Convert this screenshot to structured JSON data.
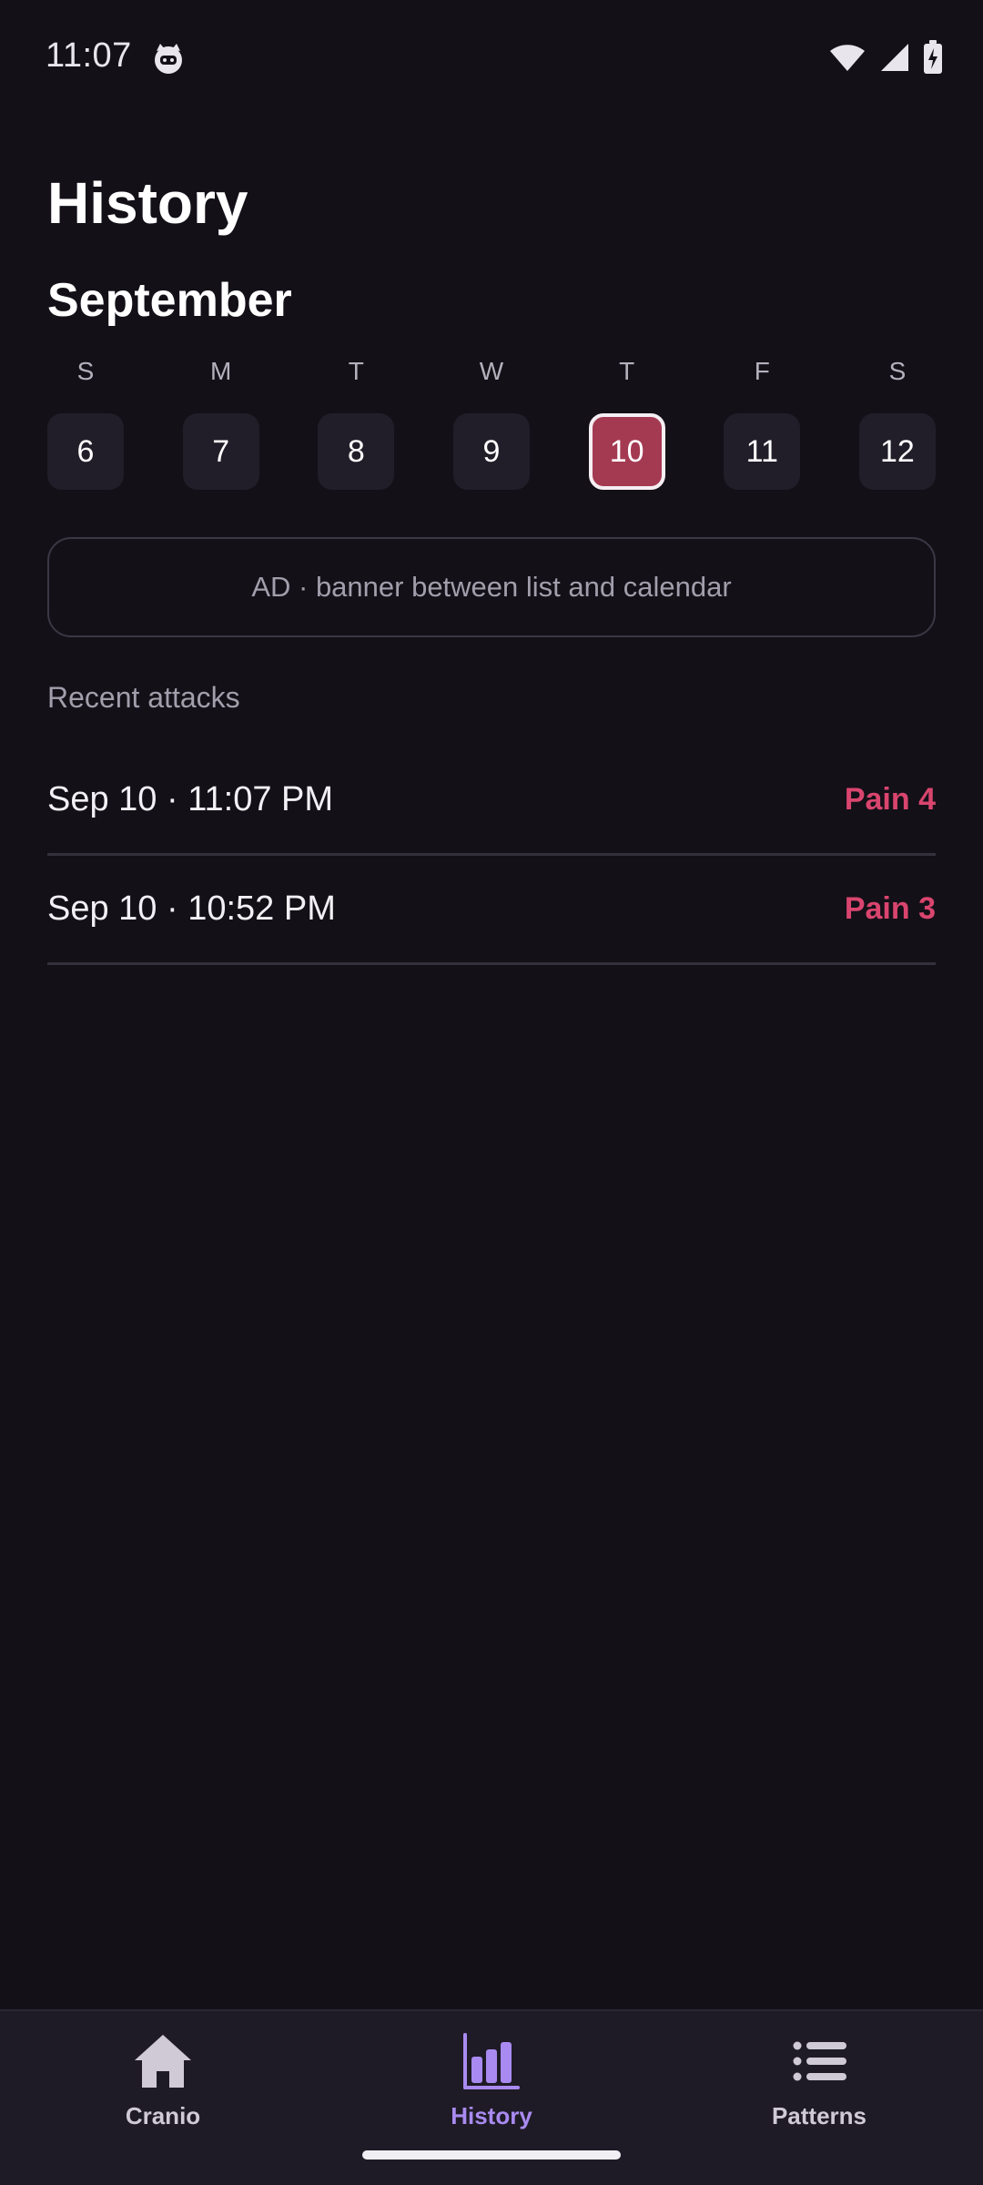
{
  "status_bar": {
    "time": "11:07",
    "app_icon": "cat-face-icon",
    "icons": [
      "wifi-icon",
      "signal-icon",
      "battery-charging-icon"
    ]
  },
  "page": {
    "title": "History",
    "month": "September"
  },
  "week": {
    "letters": [
      "S",
      "M",
      "T",
      "W",
      "T",
      "F",
      "S"
    ],
    "days": [
      "6",
      "7",
      "8",
      "9",
      "10",
      "11",
      "12"
    ],
    "selected_day": "10"
  },
  "ad": {
    "text": "AD · banner between list and calendar"
  },
  "recent": {
    "label": "Recent attacks",
    "items": [
      {
        "time": "Sep 10 · 11:07 PM",
        "pain": "Pain 4"
      },
      {
        "time": "Sep 10 · 10:52 PM",
        "pain": "Pain 3"
      }
    ]
  },
  "nav": {
    "items": [
      {
        "label": "Cranio",
        "icon": "home-icon",
        "active": false
      },
      {
        "label": "History",
        "icon": "bar-chart-icon",
        "active": true
      },
      {
        "label": "Patterns",
        "icon": "list-icon",
        "active": false
      }
    ]
  },
  "colors": {
    "background": "#131018",
    "accent": "#a98af0",
    "selected_day": "#a43a52",
    "pain": "#d9456e",
    "nav_background": "#1e1b26"
  }
}
